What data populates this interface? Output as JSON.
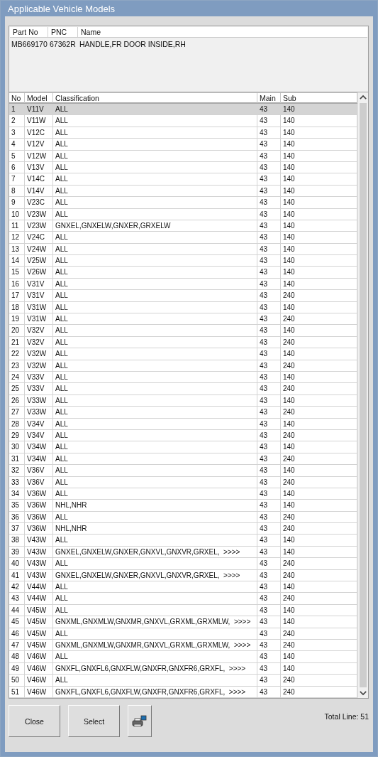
{
  "window": {
    "title": "Applicable Vehicle Models"
  },
  "part_list": {
    "columns": [
      "Part No",
      "PNC",
      "Name"
    ],
    "rows": [
      {
        "cells": [
          "MB669170",
          "67362R",
          "HANDLE,FR DOOR INSIDE,RH"
        ]
      }
    ]
  },
  "models_table": {
    "columns": [
      "No",
      "Model",
      "Classification",
      "Main",
      "Sub"
    ],
    "rows": [
      {
        "cells": [
          "1",
          "V11V",
          "ALL",
          "43",
          "140"
        ],
        "selected": true
      },
      {
        "cells": [
          "2",
          "V11W",
          "ALL",
          "43",
          "140"
        ],
        "selected": false
      },
      {
        "cells": [
          "3",
          "V12C",
          "ALL",
          "43",
          "140"
        ],
        "selected": false
      },
      {
        "cells": [
          "4",
          "V12V",
          "ALL",
          "43",
          "140"
        ],
        "selected": false
      },
      {
        "cells": [
          "5",
          "V12W",
          "ALL",
          "43",
          "140"
        ],
        "selected": false
      },
      {
        "cells": [
          "6",
          "V13V",
          "ALL",
          "43",
          "140"
        ],
        "selected": false
      },
      {
        "cells": [
          "7",
          "V14C",
          "ALL",
          "43",
          "140"
        ],
        "selected": false
      },
      {
        "cells": [
          "8",
          "V14V",
          "ALL",
          "43",
          "140"
        ],
        "selected": false
      },
      {
        "cells": [
          "9",
          "V23C",
          "ALL",
          "43",
          "140"
        ],
        "selected": false
      },
      {
        "cells": [
          "10",
          "V23W",
          "ALL",
          "43",
          "140"
        ],
        "selected": false
      },
      {
        "cells": [
          "11",
          "V23W",
          "GNXEL,GNXELW,GNXER,GRXELW",
          "43",
          "140"
        ],
        "selected": false
      },
      {
        "cells": [
          "12",
          "V24C",
          "ALL",
          "43",
          "140"
        ],
        "selected": false
      },
      {
        "cells": [
          "13",
          "V24W",
          "ALL",
          "43",
          "140"
        ],
        "selected": false
      },
      {
        "cells": [
          "14",
          "V25W",
          "ALL",
          "43",
          "140"
        ],
        "selected": false
      },
      {
        "cells": [
          "15",
          "V26W",
          "ALL",
          "43",
          "140"
        ],
        "selected": false
      },
      {
        "cells": [
          "16",
          "V31V",
          "ALL",
          "43",
          "140"
        ],
        "selected": false
      },
      {
        "cells": [
          "17",
          "V31V",
          "ALL",
          "43",
          "240"
        ],
        "selected": false
      },
      {
        "cells": [
          "18",
          "V31W",
          "ALL",
          "43",
          "140"
        ],
        "selected": false
      },
      {
        "cells": [
          "19",
          "V31W",
          "ALL",
          "43",
          "240"
        ],
        "selected": false
      },
      {
        "cells": [
          "20",
          "V32V",
          "ALL",
          "43",
          "140"
        ],
        "selected": false
      },
      {
        "cells": [
          "21",
          "V32V",
          "ALL",
          "43",
          "240"
        ],
        "selected": false
      },
      {
        "cells": [
          "22",
          "V32W",
          "ALL",
          "43",
          "140"
        ],
        "selected": false
      },
      {
        "cells": [
          "23",
          "V32W",
          "ALL",
          "43",
          "240"
        ],
        "selected": false
      },
      {
        "cells": [
          "24",
          "V33V",
          "ALL",
          "43",
          "140"
        ],
        "selected": false
      },
      {
        "cells": [
          "25",
          "V33V",
          "ALL",
          "43",
          "240"
        ],
        "selected": false
      },
      {
        "cells": [
          "26",
          "V33W",
          "ALL",
          "43",
          "140"
        ],
        "selected": false
      },
      {
        "cells": [
          "27",
          "V33W",
          "ALL",
          "43",
          "240"
        ],
        "selected": false
      },
      {
        "cells": [
          "28",
          "V34V",
          "ALL",
          "43",
          "140"
        ],
        "selected": false
      },
      {
        "cells": [
          "29",
          "V34V",
          "ALL",
          "43",
          "240"
        ],
        "selected": false
      },
      {
        "cells": [
          "30",
          "V34W",
          "ALL",
          "43",
          "140"
        ],
        "selected": false
      },
      {
        "cells": [
          "31",
          "V34W",
          "ALL",
          "43",
          "240"
        ],
        "selected": false
      },
      {
        "cells": [
          "32",
          "V36V",
          "ALL",
          "43",
          "140"
        ],
        "selected": false
      },
      {
        "cells": [
          "33",
          "V36V",
          "ALL",
          "43",
          "240"
        ],
        "selected": false
      },
      {
        "cells": [
          "34",
          "V36W",
          "ALL",
          "43",
          "140"
        ],
        "selected": false
      },
      {
        "cells": [
          "35",
          "V36W",
          "NHL,NHR",
          "43",
          "140"
        ],
        "selected": false
      },
      {
        "cells": [
          "36",
          "V36W",
          "ALL",
          "43",
          "240"
        ],
        "selected": false
      },
      {
        "cells": [
          "37",
          "V36W",
          "NHL,NHR",
          "43",
          "240"
        ],
        "selected": false
      },
      {
        "cells": [
          "38",
          "V43W",
          "ALL",
          "43",
          "140"
        ],
        "selected": false
      },
      {
        "cells": [
          "39",
          "V43W",
          "GNXEL,GNXELW,GNXER,GNXVL,GNXVR,GRXEL,  >>>>",
          "43",
          "140"
        ],
        "selected": false
      },
      {
        "cells": [
          "40",
          "V43W",
          "ALL",
          "43",
          "240"
        ],
        "selected": false
      },
      {
        "cells": [
          "41",
          "V43W",
          "GNXEL,GNXELW,GNXER,GNXVL,GNXVR,GRXEL,  >>>>",
          "43",
          "240"
        ],
        "selected": false
      },
      {
        "cells": [
          "42",
          "V44W",
          "ALL",
          "43",
          "140"
        ],
        "selected": false
      },
      {
        "cells": [
          "43",
          "V44W",
          "ALL",
          "43",
          "240"
        ],
        "selected": false
      },
      {
        "cells": [
          "44",
          "V45W",
          "ALL",
          "43",
          "140"
        ],
        "selected": false
      },
      {
        "cells": [
          "45",
          "V45W",
          "GNXML,GNXMLW,GNXMR,GNXVL,GRXML,GRXMLW,  >>>>",
          "43",
          "140"
        ],
        "selected": false
      },
      {
        "cells": [
          "46",
          "V45W",
          "ALL",
          "43",
          "240"
        ],
        "selected": false
      },
      {
        "cells": [
          "47",
          "V45W",
          "GNXML,GNXMLW,GNXMR,GNXVL,GRXML,GRXMLW,  >>>>",
          "43",
          "240"
        ],
        "selected": false
      },
      {
        "cells": [
          "48",
          "V46W",
          "ALL",
          "43",
          "140"
        ],
        "selected": false
      },
      {
        "cells": [
          "49",
          "V46W",
          "GNXFL,GNXFL6,GNXFLW,GNXFR,GNXFR6,GRXFL,  >>>>",
          "43",
          "140"
        ],
        "selected": false
      },
      {
        "cells": [
          "50",
          "V46W",
          "ALL",
          "43",
          "240"
        ],
        "selected": false
      },
      {
        "cells": [
          "51",
          "V46W",
          "GNXFL,GNXFL6,GNXFLW,GNXFR,GNXFR6,GRXFL,  >>>>",
          "43",
          "240"
        ],
        "selected": false
      }
    ]
  },
  "buttons": [
    {
      "kind": "text",
      "label": "Close"
    },
    {
      "kind": "text",
      "label": "Select"
    },
    {
      "kind": "print"
    }
  ],
  "total_line": "Total Line: 51"
}
